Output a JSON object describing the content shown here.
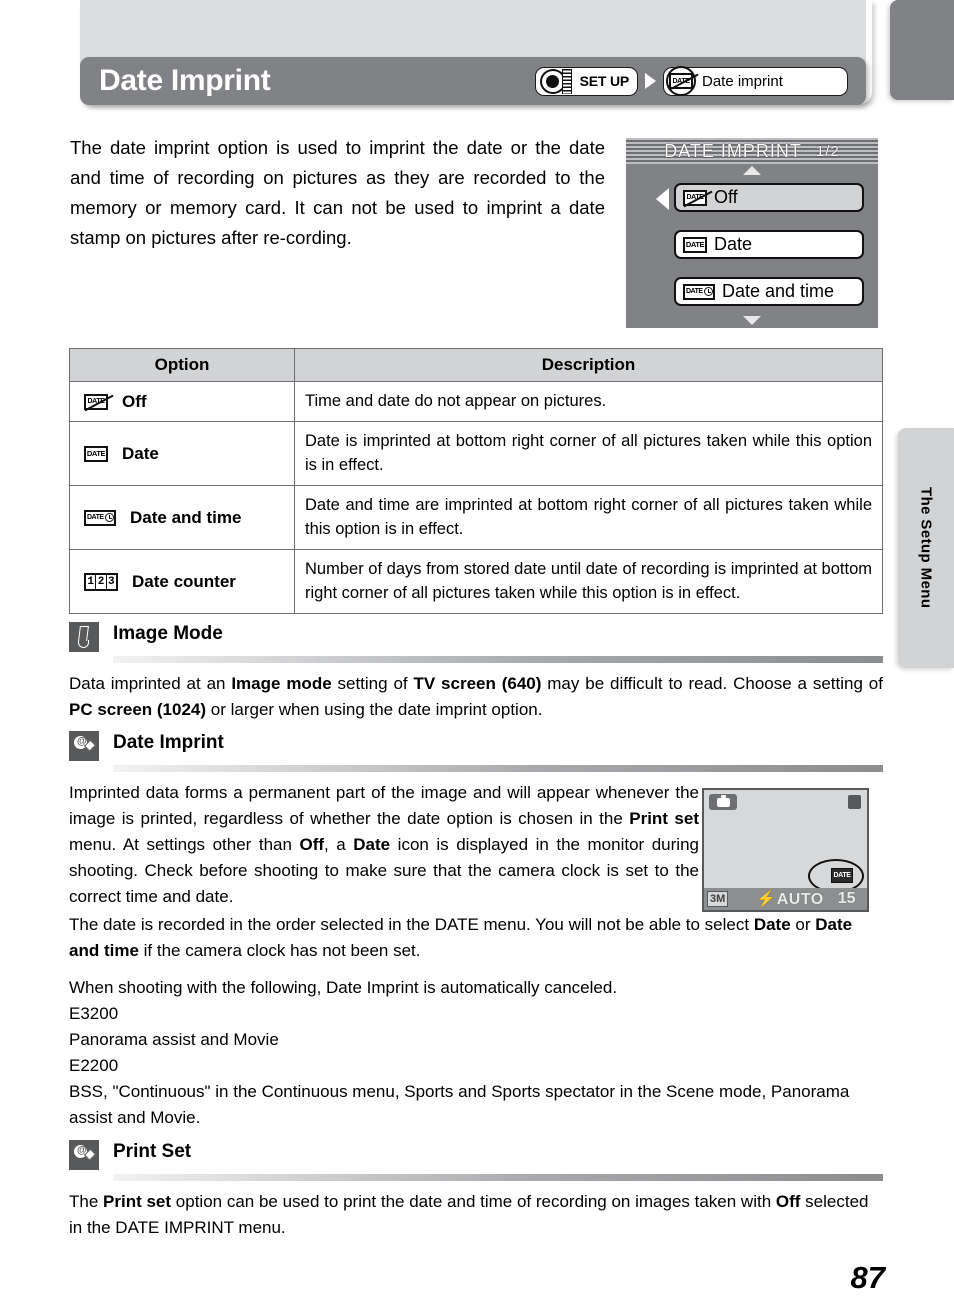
{
  "header": {
    "title": "Date Imprint",
    "setup_label": "SET UP",
    "menu_label": "Date imprint",
    "setup_icon": "setup-dial-icon",
    "arrow_icon": "path-arrow-icon",
    "date_off_icon": "date-crossed-icon"
  },
  "side_tab": {
    "label": "The Setup Menu"
  },
  "intro": "The date imprint option is used to imprint the date or the date and time of recording on pictures as they are recorded to the memory or memory card. It can not be used to imprint a date stamp on pictures after re-cording.",
  "lcd_menu": {
    "title": "DATE IMPRINT",
    "page": "1/2",
    "up_arrow_icon": "chevron-up-icon",
    "down_arrow_icon": "chevron-down-icon",
    "cursor_icon": "left-triangle-cursor-icon",
    "items": [
      {
        "label": "Off",
        "icon": "date-crossed-icon",
        "selected": true
      },
      {
        "label": "Date",
        "icon": "date-icon",
        "selected": false
      },
      {
        "label": "Date and time",
        "icon": "date-clock-icon",
        "selected": false
      }
    ]
  },
  "table": {
    "headers": [
      "Option",
      "Description"
    ],
    "rows": [
      {
        "icon": "date-crossed-icon",
        "option": "Off",
        "description": "Time and date do not appear on pictures."
      },
      {
        "icon": "date-icon",
        "option": "Date",
        "description": "Date is imprinted at bottom right corner of all pictures taken while this option is in effect."
      },
      {
        "icon": "date-clock-icon",
        "option": "Date and time",
        "description": "Date and time are imprinted at bottom right corner of all pictures taken while this option is in effect."
      },
      {
        "icon": "date-counter-icon",
        "option": "Date counter",
        "description": "Number of days from stored date until date of recording is imprinted at bottom right corner of all pictures taken while this option is in effect."
      }
    ]
  },
  "notes": {
    "image_mode": {
      "icon": "pencil-icon",
      "title": "Image Mode",
      "body_html": "Data imprinted at an <b>Image mode</b> setting of <b>TV screen (640)</b> may be difficult to read. Choose a setting of <b>PC screen (1024)</b> or larger when using the date imprint option."
    },
    "date_imprint": {
      "icon": "tip-bulb-icon",
      "title": "Date Imprint",
      "para1_html": "Imprinted data forms a permanent part of the image and will appear whenever the image is printed, regardless of whether the date option is chosen in the <b>Print set</b> menu. At settings other than <b>Off</b>, a <b>Date</b> icon is displayed in the monitor during shooting. Check before shooting to make sure that the camera clock is set to the correct time and date.",
      "para2_html": "The date is recorded in the order selected in the DATE menu. You will not be able to select <b>Date</b> or <b>Date and time</b> if the camera clock has not been set.",
      "para3_lines": [
        "When shooting with the following, Date Imprint is automatically canceled.",
        "E3200",
        "Panorama assist and Movie",
        "E2200",
        "BSS, \"Continuous\" in the Continuous menu, Sports and Sports spectator in the Scene mode, Panorama assist and Movie."
      ]
    },
    "print_set": {
      "icon": "tip-bulb-icon",
      "title": "Print Set",
      "body_html": "The <b>Print set</b> option can be used to print the date and time of recording on images taken with <b>Off</b> selected in the DATE IMPRINT menu."
    }
  },
  "lcd_shot": {
    "mode_icon": "camera-mode-icon",
    "battery_icon": "battery-icon",
    "megapixels": "3M",
    "flash_mode": "AUTO",
    "flash_icon": "flash-bolt-icon",
    "shots_remaining": "15",
    "date_badge": "DATE",
    "highlight_icon": "ellipse-highlight-icon"
  },
  "page_number": "87"
}
